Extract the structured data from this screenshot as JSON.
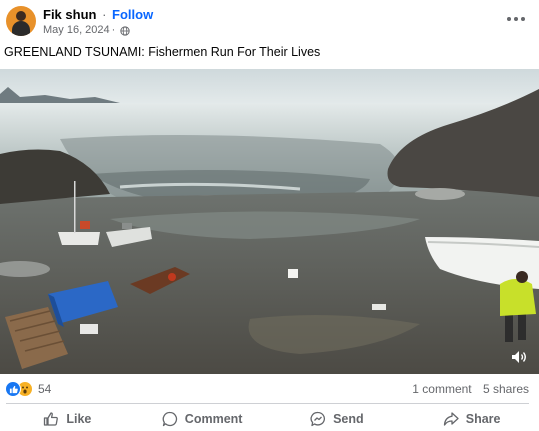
{
  "post": {
    "author": "Fik shun",
    "separator": "·",
    "follow_label": "Follow",
    "date": "May 16, 2024",
    "meta_separator": "·",
    "privacy_icon": "globe-icon",
    "caption": "GREENLAND TSUNAMI: Fishermen Run For Their Lives"
  },
  "video": {
    "description": "Greenland tsunami footage: wave surging onto shore, boats and debris, person in yellow jacket running",
    "volume_icon": "speaker-icon"
  },
  "reactions": {
    "icons": [
      "like-icon",
      "wow-icon"
    ],
    "count": "54",
    "comments": "1 comment",
    "shares": "5 shares"
  },
  "actions": {
    "like": "Like",
    "comment": "Comment",
    "send": "Send",
    "share": "Share"
  },
  "colors": {
    "link": "#0866ff",
    "secondary_text": "#65676b",
    "like_blue": "#1877f2",
    "wow_yellow": "#f7b125",
    "jacket_yellow": "#c8e02a"
  }
}
